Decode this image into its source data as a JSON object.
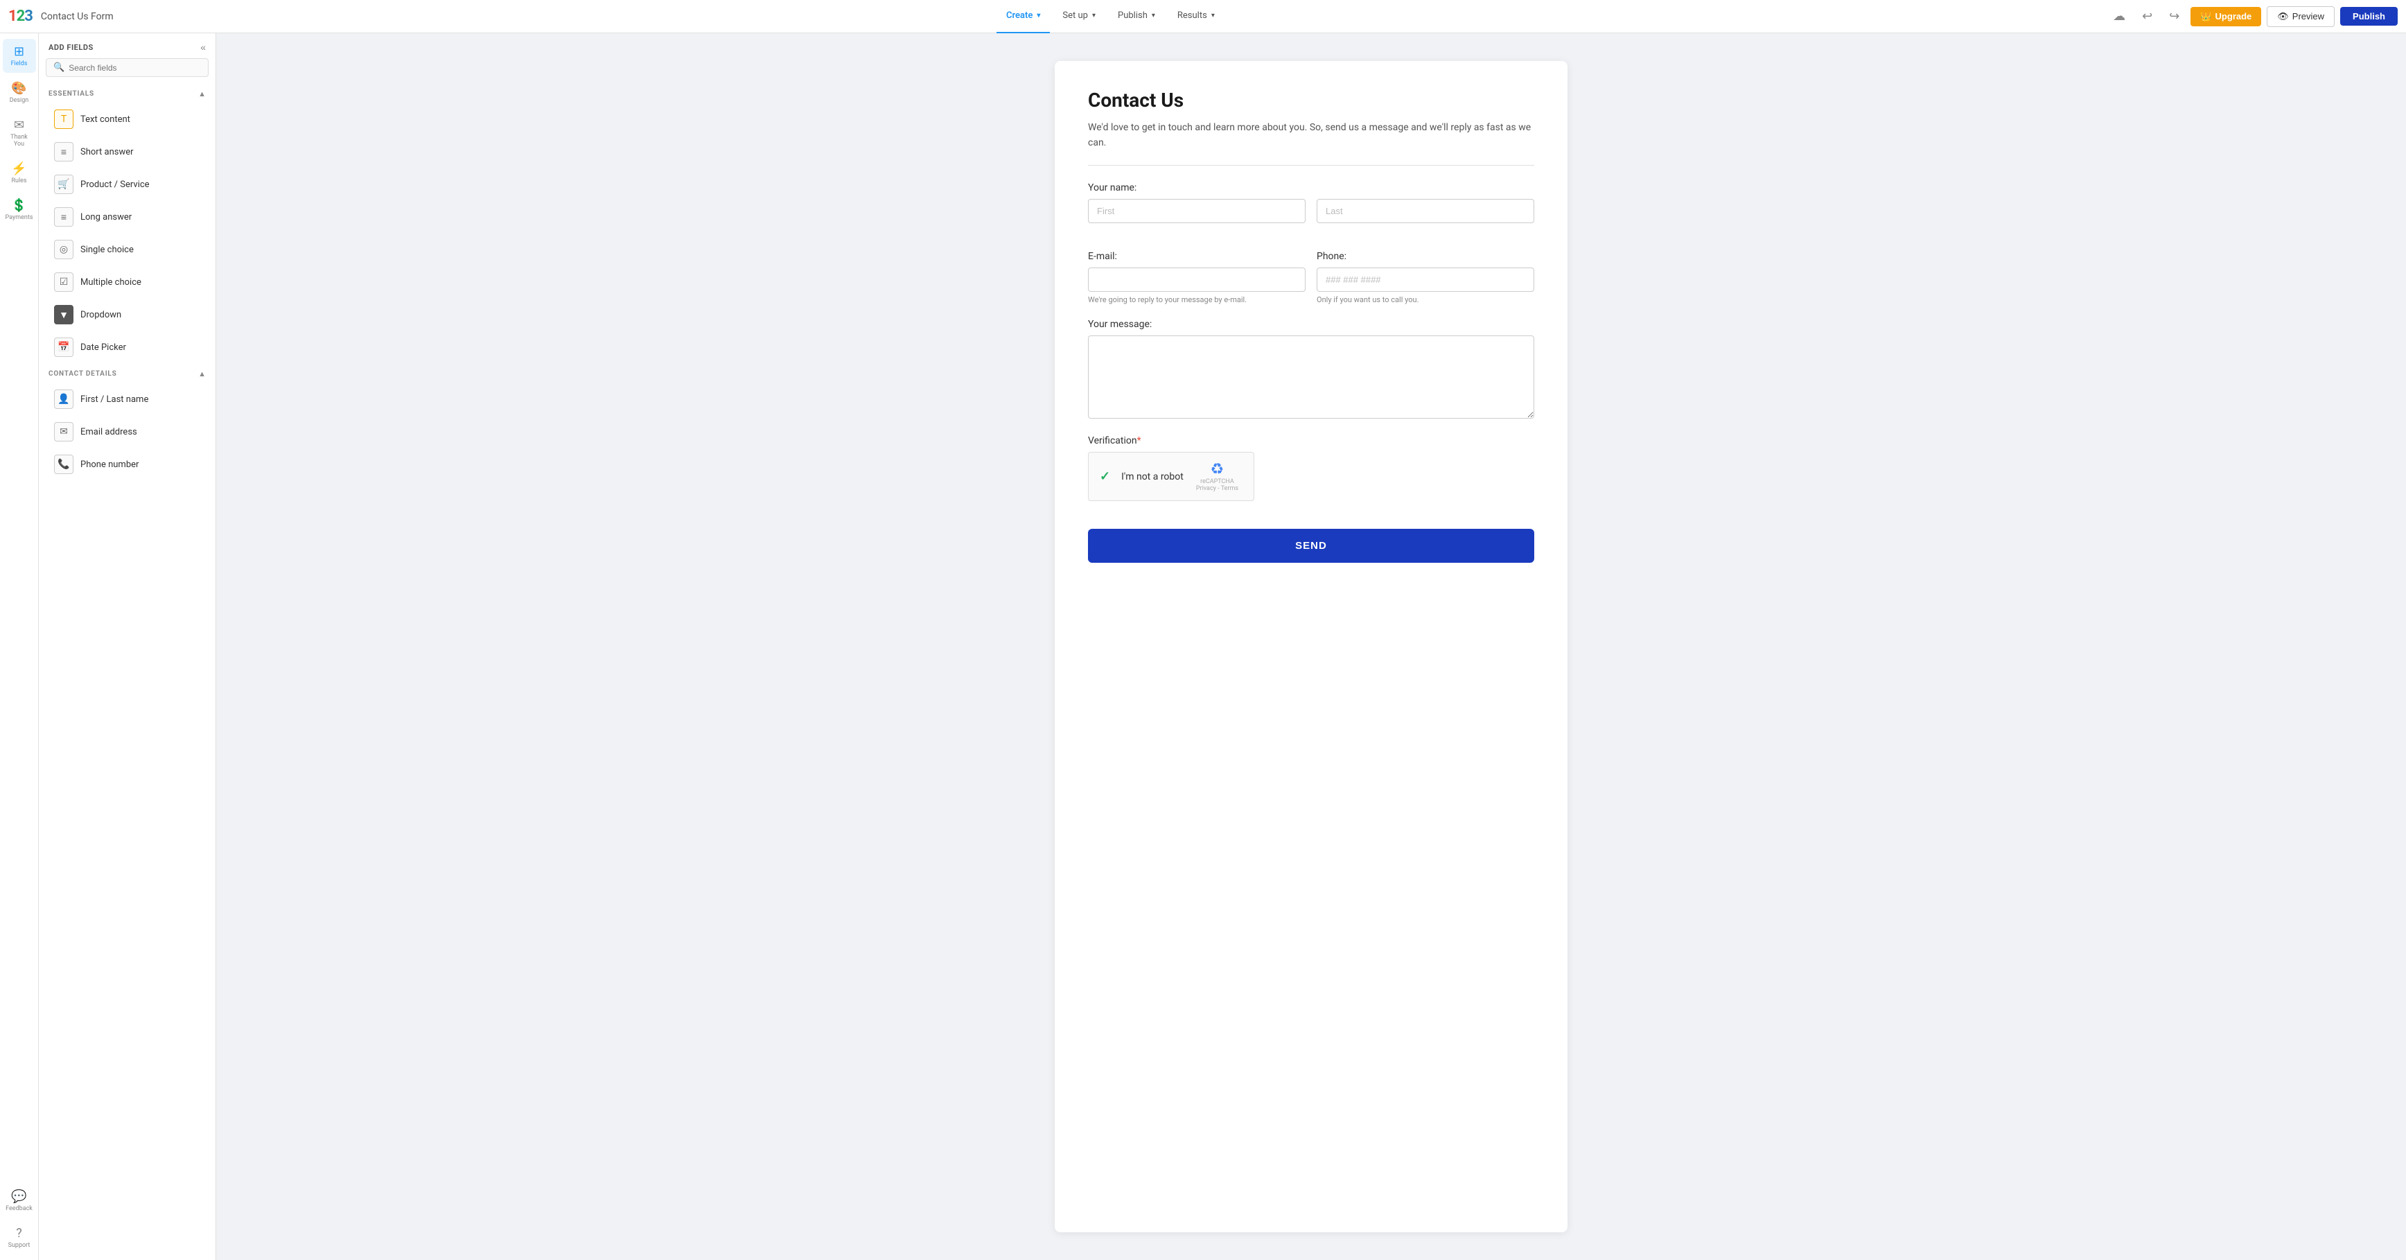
{
  "app": {
    "logo": "123",
    "form_name": "Contact Us Form"
  },
  "nav": {
    "tabs": [
      {
        "label": "Create",
        "active": true
      },
      {
        "label": "Set up",
        "active": false
      },
      {
        "label": "Publish",
        "active": false
      },
      {
        "label": "Results",
        "active": false
      }
    ],
    "upgrade_label": "Upgrade",
    "preview_label": "Preview",
    "publish_label": "Publish"
  },
  "left_sidebar": {
    "items": [
      {
        "id": "fields",
        "label": "Fields",
        "icon": "⊞",
        "active": true
      },
      {
        "id": "design",
        "label": "Design",
        "icon": "🎨",
        "active": false
      },
      {
        "id": "thank-you",
        "label": "Thank You",
        "icon": "✉",
        "active": false
      },
      {
        "id": "rules",
        "label": "Rules",
        "icon": "⚡",
        "active": false
      },
      {
        "id": "payments",
        "label": "Payments",
        "icon": "💲",
        "active": false
      },
      {
        "id": "feedback",
        "label": "Feedback",
        "icon": "💬",
        "active": false
      },
      {
        "id": "support",
        "label": "Support",
        "icon": "?",
        "active": false
      }
    ]
  },
  "fields_panel": {
    "title": "ADD FIELDS",
    "search_placeholder": "Search fields",
    "sections": [
      {
        "id": "essentials",
        "title": "ESSENTIALS",
        "expanded": true,
        "items": [
          {
            "label": "Text content",
            "icon": "T",
            "icon_style": "orange"
          },
          {
            "label": "Short answer",
            "icon": "≡",
            "icon_style": "default"
          },
          {
            "label": "Product / Service",
            "icon": "🛒",
            "icon_style": "default"
          },
          {
            "label": "Long answer",
            "icon": "≡",
            "icon_style": "default"
          },
          {
            "label": "Single choice",
            "icon": "◎",
            "icon_style": "default"
          },
          {
            "label": "Multiple choice",
            "icon": "☑",
            "icon_style": "default"
          },
          {
            "label": "Dropdown",
            "icon": "▼",
            "icon_style": "dark"
          },
          {
            "label": "Date Picker",
            "icon": "📅",
            "icon_style": "default"
          }
        ]
      },
      {
        "id": "contact_details",
        "title": "CONTACT DETAILS",
        "expanded": true,
        "items": [
          {
            "label": "First / Last name",
            "icon": "👤",
            "icon_style": "default"
          },
          {
            "label": "Email address",
            "icon": "✉",
            "icon_style": "default"
          },
          {
            "label": "Phone number",
            "icon": "📞",
            "icon_style": "default"
          }
        ]
      }
    ]
  },
  "form": {
    "title": "Contact Us",
    "description": "We'd love to get in touch and learn more about you. So, send us a message and we'll reply as fast as we can.",
    "fields": {
      "your_name_label": "Your name:",
      "first_placeholder": "First",
      "last_placeholder": "Last",
      "email_label": "E-mail:",
      "email_hint": "We're going to reply to your message by e-mail.",
      "phone_label": "Phone:",
      "phone_placeholder": "### ### ####",
      "phone_hint": "Only if you want us to call you.",
      "message_label": "Your message:",
      "verification_label": "Verification",
      "captcha_text": "I'm not a robot",
      "captcha_sub1": "reCAPTCHA",
      "captcha_sub2": "Privacy - Terms",
      "send_label": "SEND"
    }
  }
}
